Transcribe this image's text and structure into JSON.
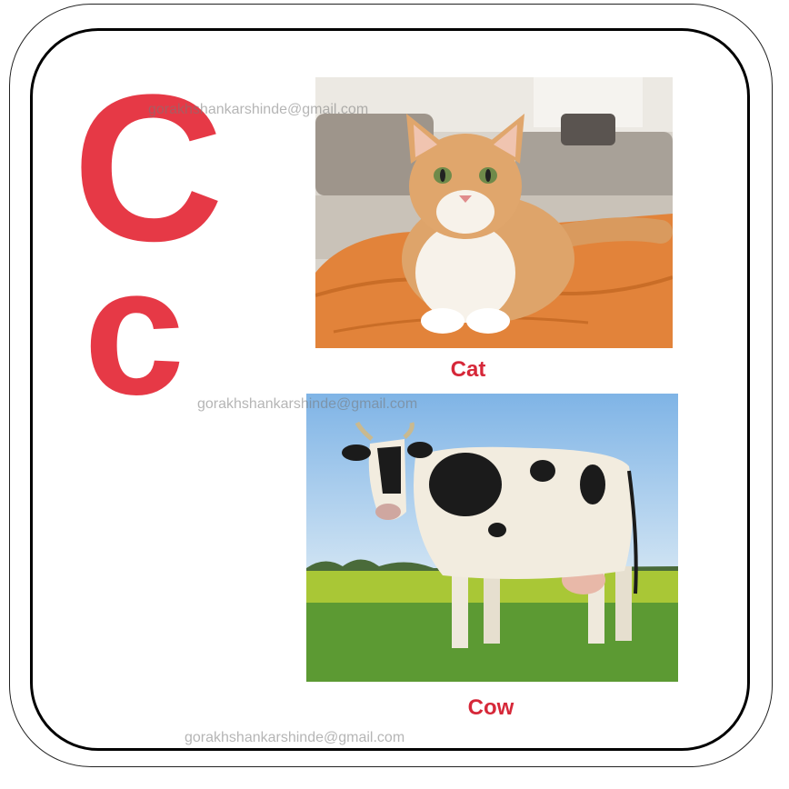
{
  "letters": {
    "upper": "C",
    "lower": "c"
  },
  "cards": [
    {
      "caption": "Cat",
      "icon": "cat-photo"
    },
    {
      "caption": "Cow",
      "icon": "cow-photo"
    }
  ],
  "watermarks": [
    "gorakhshankarshinde@gmail.com",
    "gorakhshankarshinde@gmail.com",
    "gorakhshankarshinde@gmail.com"
  ],
  "colors": {
    "letter": "#e63946",
    "caption": "#d62839",
    "frame": "#000000"
  }
}
